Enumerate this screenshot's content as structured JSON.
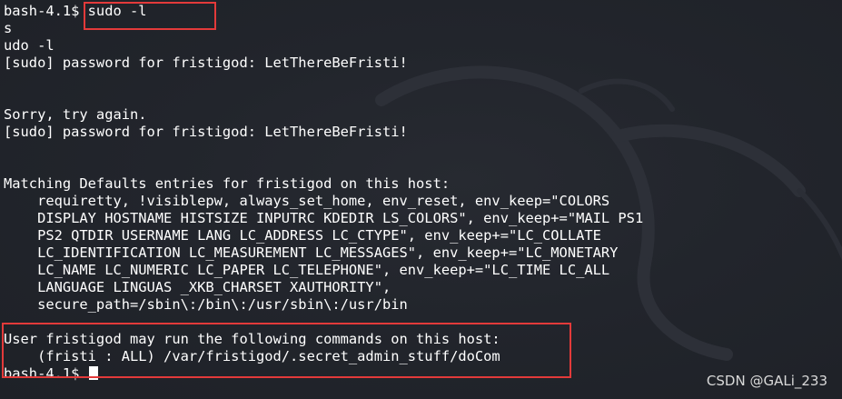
{
  "terminal": {
    "lines": [
      {
        "text": "bash-4.1$ sudo -l"
      },
      {
        "text": "s"
      },
      {
        "text": "udo -l"
      },
      {
        "text": "[sudo] password for fristigod: LetThereBeFristi!"
      },
      {
        "text": ""
      },
      {
        "text": ""
      },
      {
        "text": "Sorry, try again."
      },
      {
        "text": "[sudo] password for fristigod: LetThereBeFristi!"
      },
      {
        "text": ""
      },
      {
        "text": ""
      },
      {
        "text": "Matching Defaults entries for fristigod on this host:"
      },
      {
        "text": "    requiretty, !visiblepw, always_set_home, env_reset, env_keep=\"COLORS"
      },
      {
        "text": "    DISPLAY HOSTNAME HISTSIZE INPUTRC KDEDIR LS_COLORS\", env_keep+=\"MAIL PS1"
      },
      {
        "text": "    PS2 QTDIR USERNAME LANG LC_ADDRESS LC_CTYPE\", env_keep+=\"LC_COLLATE"
      },
      {
        "text": "    LC_IDENTIFICATION LC_MEASUREMENT LC_MESSAGES\", env_keep+=\"LC_MONETARY"
      },
      {
        "text": "    LC_NAME LC_NUMERIC LC_PAPER LC_TELEPHONE\", env_keep+=\"LC_TIME LC_ALL"
      },
      {
        "text": "    LANGUAGE LINGUAS _XKB_CHARSET XAUTHORITY\","
      },
      {
        "text": "    secure_path=/sbin\\:/bin\\:/usr/sbin\\:/usr/bin"
      },
      {
        "text": ""
      },
      {
        "text": "User fristigod may run the following commands on this host:"
      },
      {
        "text": "    (fristi : ALL) /var/fristigod/.secret_admin_stuff/doCom"
      },
      {
        "text": "bash-4.1$ "
      }
    ],
    "colors": {
      "background": "#22252c",
      "foreground": "#ffffff",
      "annotation": "#e33a3a"
    }
  },
  "watermark": {
    "text": "CSDN @GALi_233"
  }
}
